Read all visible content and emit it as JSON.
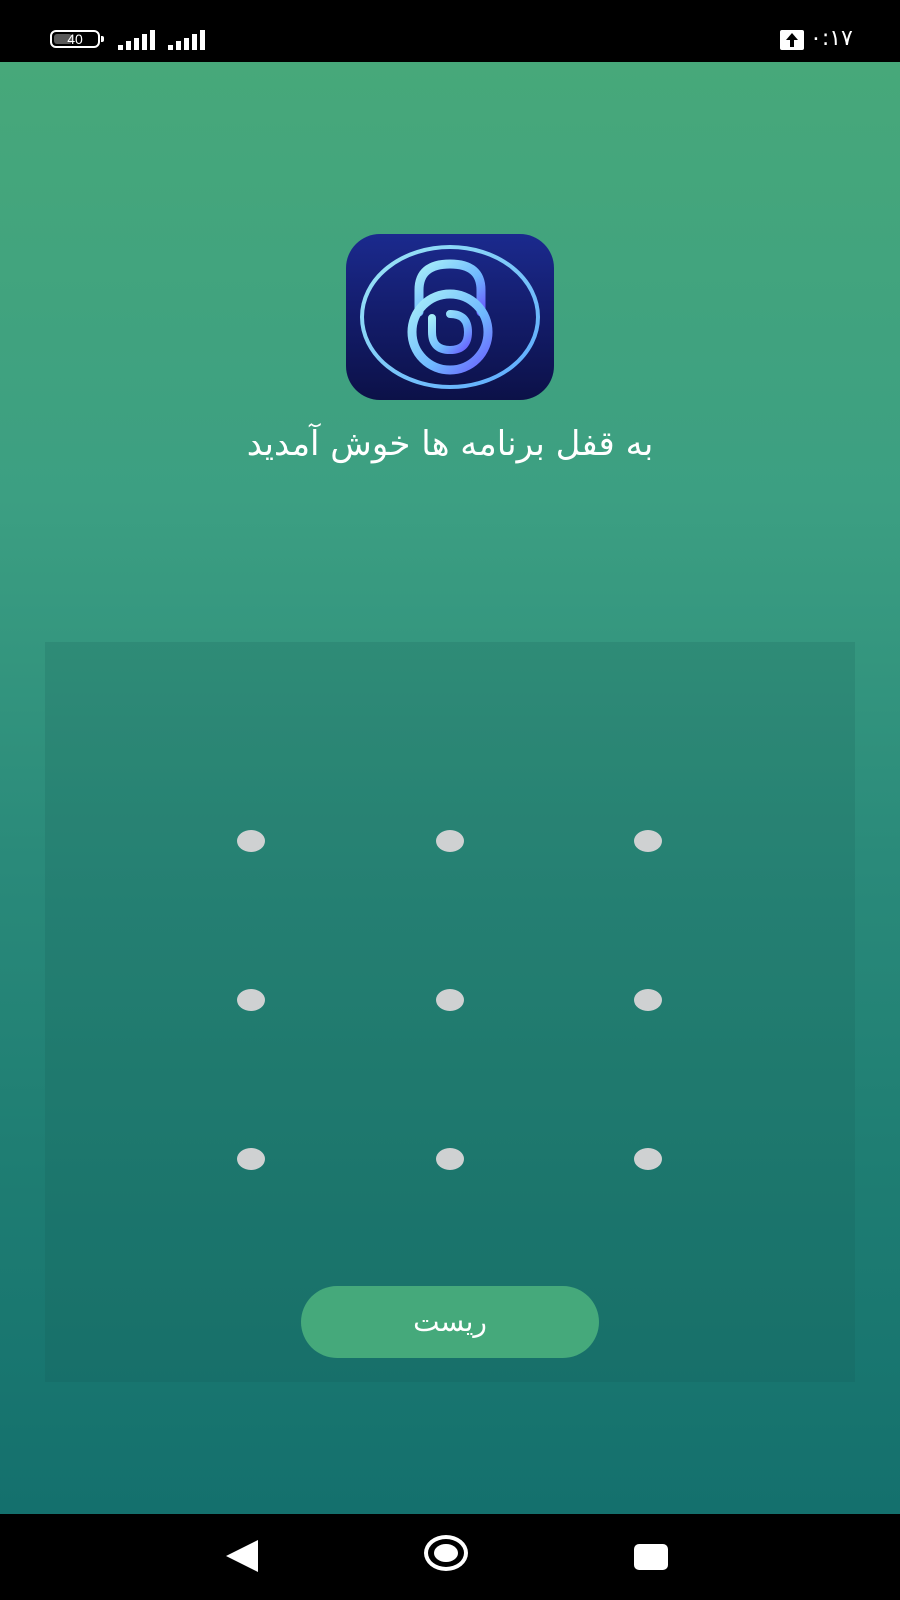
{
  "status_bar": {
    "battery_level": "40",
    "clock": "۰:۱۷",
    "icons": [
      "battery-icon",
      "signal-icon",
      "signal-icon",
      "upload-icon"
    ]
  },
  "app": {
    "icon_name": "lock-icon",
    "welcome_text": "به قفل برنامه ها خوش آمدید"
  },
  "pattern": {
    "rows": 3,
    "cols": 3
  },
  "actions": {
    "reset_label": "ریست"
  },
  "nav_bar": {
    "icons": [
      "back-icon",
      "home-icon",
      "recents-icon"
    ]
  },
  "colors": {
    "accent": "#45a97b",
    "dot": "#cfd1d2",
    "icon_bg": "#131c6a"
  }
}
